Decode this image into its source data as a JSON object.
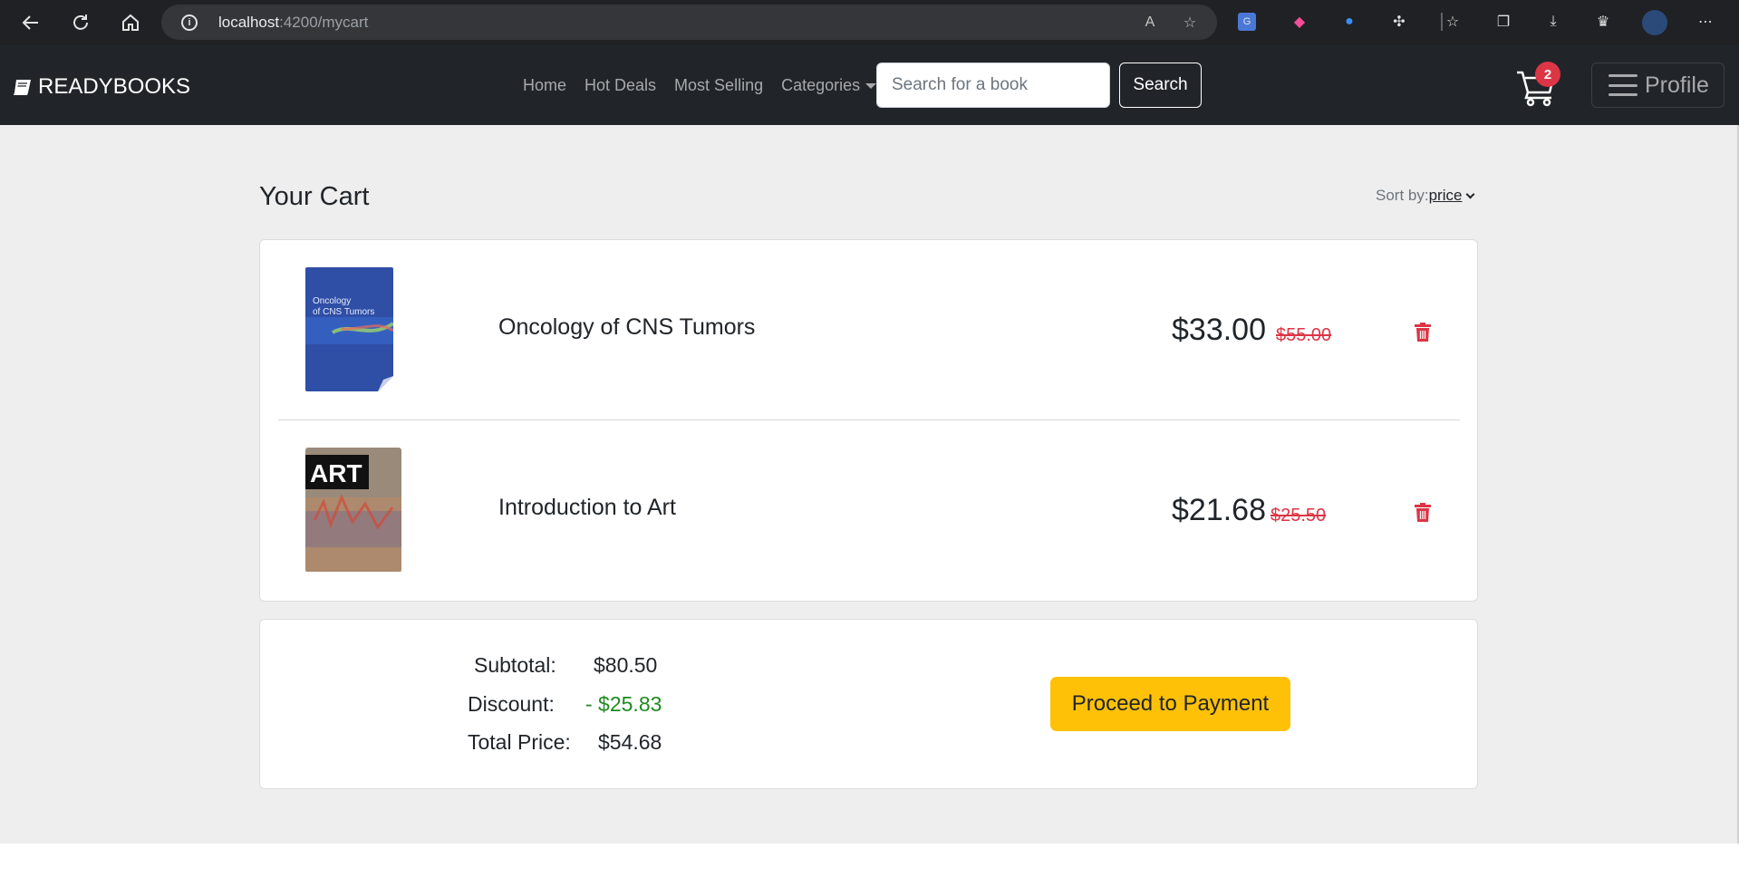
{
  "browser": {
    "url_host": "localhost",
    "url_path": ":4200/mycart"
  },
  "navbar": {
    "brand": "READYBOOKS",
    "links": [
      "Home",
      "Hot Deals",
      "Most Selling"
    ],
    "categories_label": "Categories",
    "search_placeholder": "Search for a book",
    "search_label": "Search",
    "cart_count": "2",
    "profile_label": "Profile"
  },
  "cart": {
    "title": "Your Cart",
    "sort_label": "Sort by:",
    "sort_value": "price",
    "items": [
      {
        "title": "Oncology of CNS Tumors",
        "price": "$33.00",
        "old_price": "$55.00",
        "cover_text": "Oncology of CNS Tumors"
      },
      {
        "title": "Introduction to Art",
        "price": "$21.68",
        "old_price": "$25.50",
        "cover_text": "ART"
      }
    ]
  },
  "summary": {
    "subtotal_label": "Subtotal:",
    "subtotal_value": "$80.50",
    "discount_label": "Discount:",
    "discount_value": "- $25.83",
    "total_label": "Total Price:",
    "total_value": "$54.68",
    "pay_label": "Proceed to Payment"
  },
  "colors": {
    "navbar_bg": "#212529",
    "accent_yellow": "#ffc107",
    "danger_red": "#dc3545",
    "discount_green": "#1f8a1f",
    "page_bg": "#eeeeee"
  }
}
